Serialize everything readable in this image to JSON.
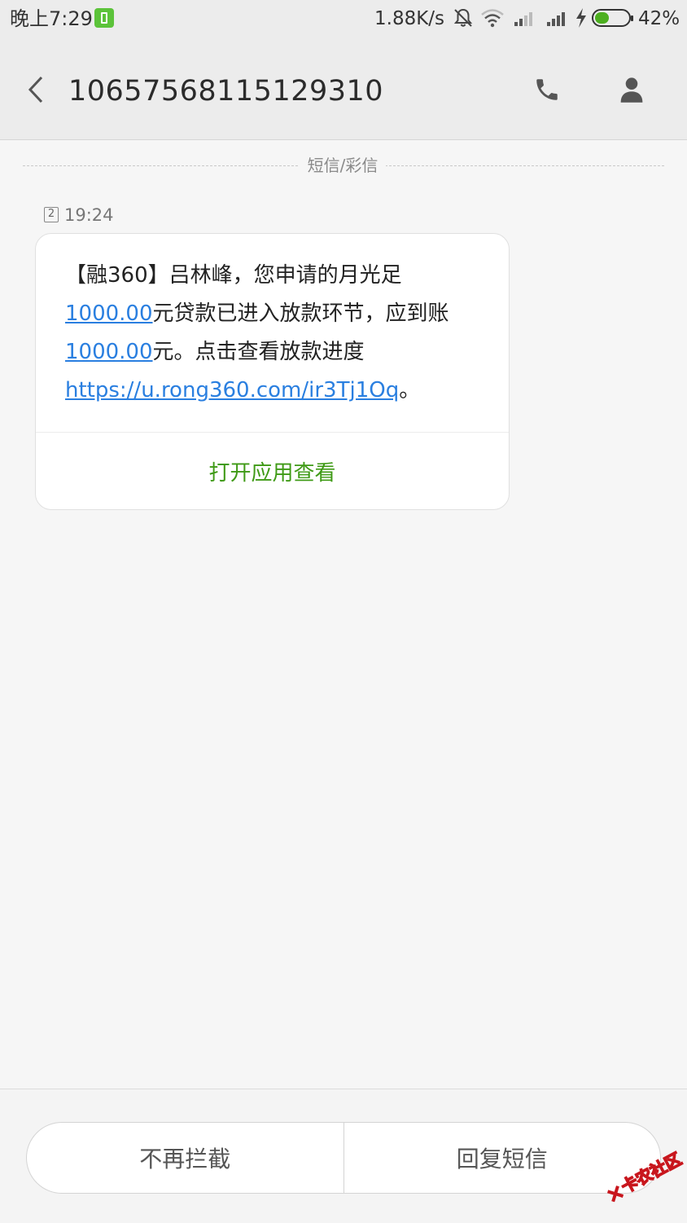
{
  "status_bar": {
    "time": "晚上7:29",
    "net_speed": "1.88K/s",
    "battery_percent": "42%",
    "battery_level": 0.42
  },
  "header": {
    "title": "10657568115129310"
  },
  "thread": {
    "divider_label": "短信/彩信",
    "messages": [
      {
        "sim_slot": "2",
        "time": "19:24",
        "text_parts": {
          "p1": "【融360】吕林峰，您申请的月光足",
          "amount1": "1000.00",
          "p2": "元贷款已进入放款环节，应到账",
          "amount2": "1000.00",
          "p3": "元。点击查看放款进度",
          "url": "https://u.rong360.com/ir3Tj1Oq",
          "p4": "。"
        },
        "action_label": "打开应用查看"
      }
    ]
  },
  "bottom_bar": {
    "unblock_label": "不再拦截",
    "reply_label": "回复短信"
  },
  "watermark": {
    "text": "卡农社区"
  },
  "colors": {
    "link": "#2a7fe0",
    "action": "#3f9a16",
    "battery_fill": "#4caf1f",
    "app_icon": "#5cc33a",
    "watermark": "#c8161d"
  }
}
